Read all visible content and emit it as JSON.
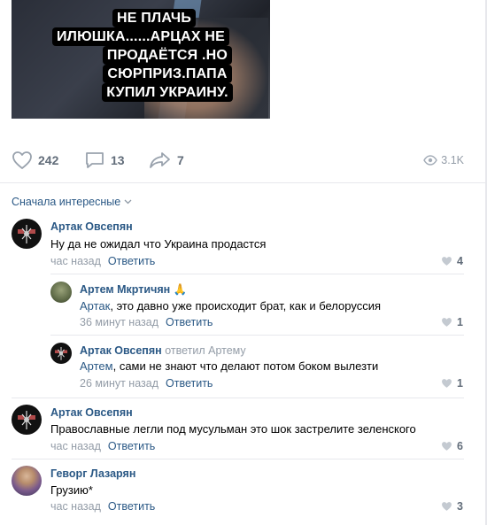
{
  "post": {
    "caption_lines": [
      "НЕ ПЛАЧЬ",
      "ИЛЮШКА......АРЦАХ НЕ",
      "ПРОДАЁТСЯ .НО",
      "СЮРПРИЗ.ПАПА",
      "КУПИЛ УКРАИНУ."
    ]
  },
  "actions": {
    "likes": "242",
    "comments": "13",
    "shares": "7",
    "views": "3.1K"
  },
  "sort_label": "Сначала интересные",
  "comments": [
    {
      "author": "Артак Овсепян",
      "text": "Ну да не ожидал что Украина продастся",
      "time": "час назад",
      "reply_label": "Ответить",
      "likes": "4"
    },
    {
      "author": "Артем Мкртичян 🙏",
      "mention": "Артак",
      "text": ", это давно уже происходит брат, как и белоруссия",
      "time": "36 минут назад",
      "reply_label": "Ответить",
      "likes": "1"
    },
    {
      "author": "Артак Овсепян",
      "replied_to": "ответил Артему",
      "mention": "Артем",
      "text": ", сами не знают что делают потом боком вылезти",
      "time": "26 минут назад",
      "reply_label": "Ответить",
      "likes": "1"
    },
    {
      "author": "Артак Овсепян",
      "text": "Православные легли под мусульман это шок застрелите зеленского",
      "time": "час назад",
      "reply_label": "Ответить",
      "likes": "6"
    },
    {
      "author": "Геворг Лазарян",
      "text": "Грузию*",
      "time": "час назад",
      "reply_label": "Ответить",
      "likes": "3"
    }
  ],
  "colors": {
    "link": "#2a5885",
    "muted": "#939ca7",
    "icon": "#626d7a",
    "divider": "#e7e8ec"
  }
}
